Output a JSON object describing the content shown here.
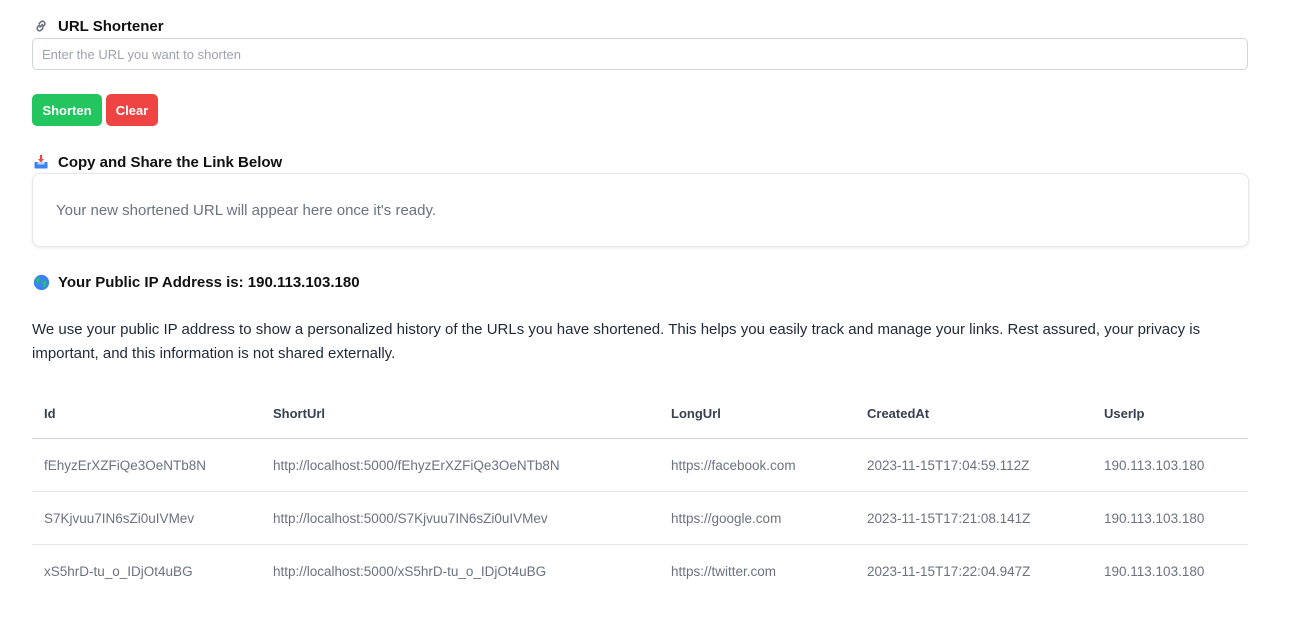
{
  "shortener": {
    "title": "URL Shortener",
    "title_icon": "link-icon",
    "input_value": "",
    "input_placeholder": "Enter the URL you want to shorten",
    "shorten_label": "Shorten",
    "clear_label": "Clear"
  },
  "share": {
    "title": "Copy and Share the Link Below",
    "title_icon": "inbox-tray-icon",
    "placeholder_text": "Your new shortened URL will appear here once it's ready."
  },
  "ip": {
    "title": "Your Public IP Address is: 190.113.103.180",
    "title_icon": "globe-icon"
  },
  "info_text": "We use your public IP address to show a personalized history of the URLs you have shortened. This helps you easily track and manage your links. Rest assured, your privacy is important, and this information is not shared externally.",
  "table": {
    "headers": [
      "Id",
      "ShortUrl",
      "LongUrl",
      "CreatedAt",
      "UserIp"
    ],
    "rows": [
      [
        "fEhyzErXZFiQe3OeNTb8N",
        "http://localhost:5000/fEhyzErXZFiQe3OeNTb8N",
        "https://facebook.com",
        "2023-11-15T17:04:59.112Z",
        "190.113.103.180"
      ],
      [
        "S7Kjvuu7IN6sZi0uIVMev",
        "http://localhost:5000/S7Kjvuu7IN6sZi0uIVMev",
        "https://google.com",
        "2023-11-15T17:21:08.141Z",
        "190.113.103.180"
      ],
      [
        "xS5hrD-tu_o_IDjOt4uBG",
        "http://localhost:5000/xS5hrD-tu_o_IDjOt4uBG",
        "https://twitter.com",
        "2023-11-15T17:22:04.947Z",
        "190.113.103.180"
      ]
    ]
  },
  "colors": {
    "shorten_button": "#22c55e",
    "clear_button": "#ef4444"
  }
}
